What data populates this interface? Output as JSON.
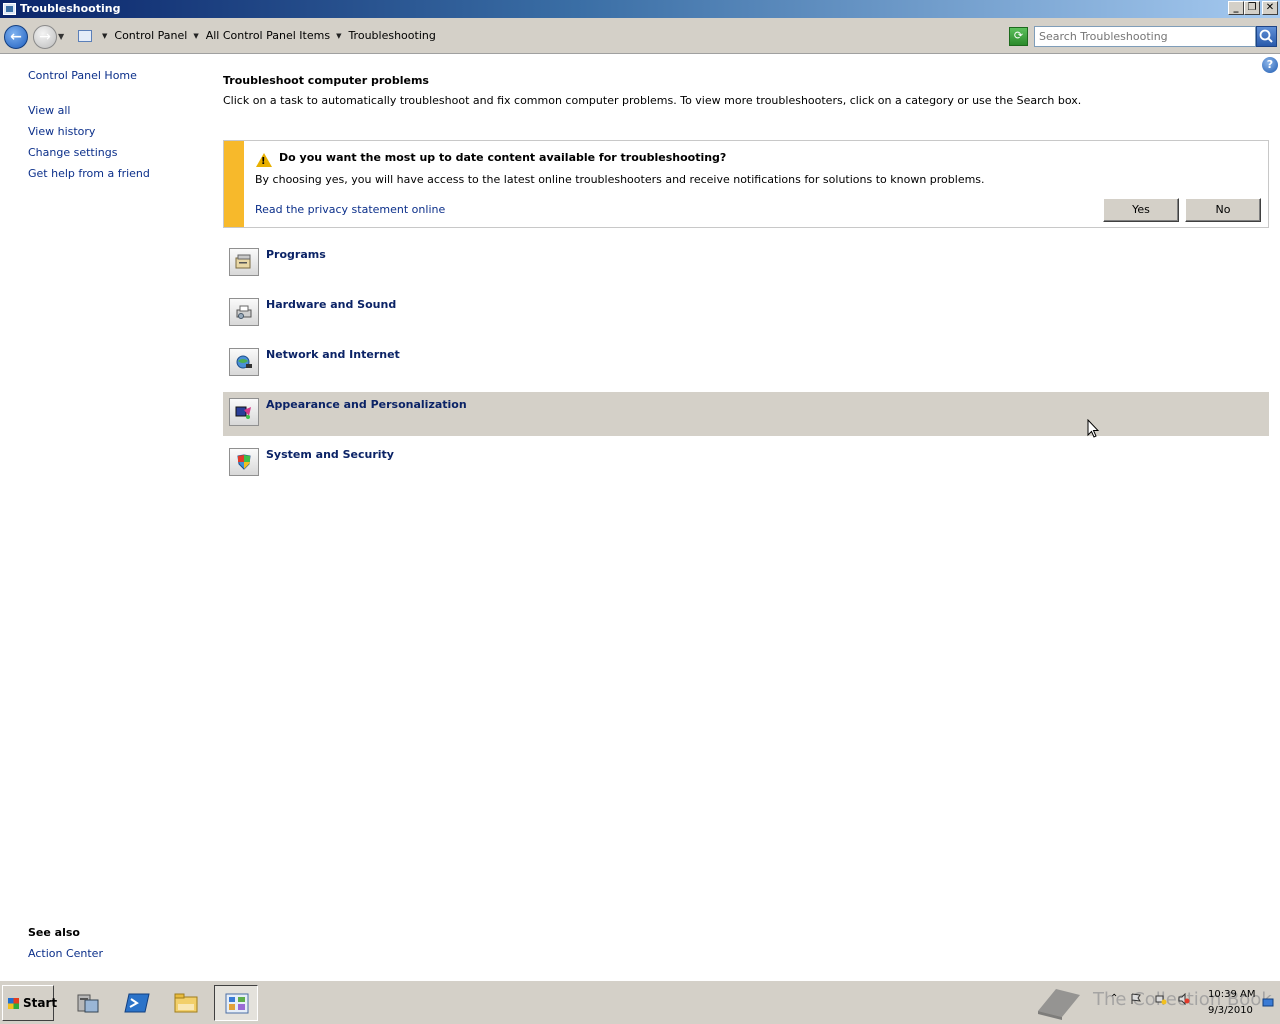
{
  "window": {
    "title": "Troubleshooting"
  },
  "address": {
    "crumbs": [
      "Control Panel",
      "All Control Panel Items",
      "Troubleshooting"
    ],
    "search_placeholder": "Search Troubleshooting"
  },
  "sidebar": {
    "home": "Control Panel Home",
    "links": [
      "View all",
      "View history",
      "Change settings",
      "Get help from a friend"
    ],
    "see_also_title": "See also",
    "see_also_links": [
      "Action Center"
    ]
  },
  "main": {
    "heading": "Troubleshoot computer problems",
    "description": "Click on a task to automatically troubleshoot and fix common computer problems. To view more troubleshooters, click on a category or use the Search box."
  },
  "notice": {
    "title": "Do you want the most up to date content available for troubleshooting?",
    "text": "By choosing yes, you will have access to the latest online troubleshooters and receive notifications for solutions to known problems.",
    "link": "Read the privacy statement online",
    "yes_label": "Yes",
    "no_label": "No"
  },
  "categories": [
    {
      "label": "Programs",
      "icon": "programs-icon"
    },
    {
      "label": "Hardware and Sound",
      "icon": "printer-icon"
    },
    {
      "label": "Network and Internet",
      "icon": "globe-network-icon"
    },
    {
      "label": "Appearance and Personalization",
      "icon": "palette-icon"
    },
    {
      "label": "System and Security",
      "icon": "shield-icon"
    }
  ],
  "taskbar": {
    "start_label": "Start",
    "apps": [
      "server-manager-icon",
      "powershell-icon",
      "explorer-icon",
      "control-panel-icon"
    ],
    "clock_time": "10:39 AM",
    "clock_date": "9/3/2010",
    "watermark": "The Collection Book"
  },
  "colors": {
    "link": "#0b2f8a",
    "category_text": "#0b2366",
    "notice_bar": "#f7b92b",
    "hover_row": "#d4d0c8"
  }
}
